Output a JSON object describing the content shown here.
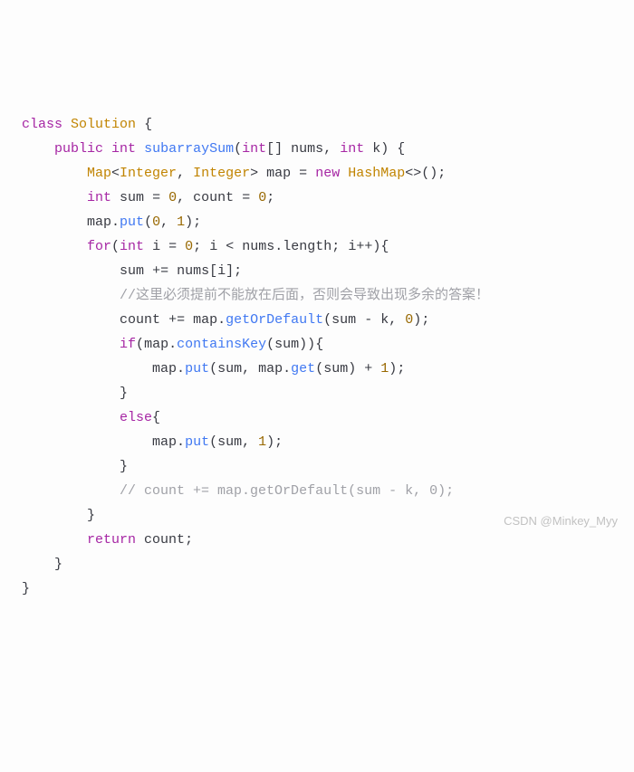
{
  "code": {
    "l1": {
      "kw_class": "class",
      "cls": "Solution",
      "brace": "{"
    },
    "l2": {
      "kw_public": "public",
      "kw_int": "int",
      "fn": "subarraySum",
      "p_open": "(",
      "kw_int2": "int",
      "arr": "[]",
      "var_nums": "nums",
      "comma": ",",
      "kw_int3": "int",
      "var_k": "k",
      "p_close": ")",
      "brace": "{"
    },
    "l3": {
      "cls_map": "Map",
      "lt": "<",
      "cls_int1": "Integer",
      "comma": ",",
      "cls_int2": "Integer",
      "gt": ">",
      "var_map": "map",
      "eq": "=",
      "kw_new": "new",
      "cls_hash": "HashMap",
      "diam": "<>",
      "call": "()",
      "semi": ";"
    },
    "l4": {
      "kw_int": "int",
      "var_sum": "sum",
      "eq1": "=",
      "n0": "0",
      "comma": ",",
      "var_count": "count",
      "eq2": "=",
      "n0b": "0",
      "semi": ";"
    },
    "l5": {
      "var_map": "map",
      "dot": ".",
      "fn_put": "put",
      "p_open": "(",
      "n0": "0",
      "comma": ",",
      "n1": "1",
      "p_close": ")",
      "semi": ";"
    },
    "l6": {
      "kw_for": "for",
      "p_open": "(",
      "kw_int": "int",
      "var_i": "i",
      "eq": "=",
      "n0": "0",
      "semi1": ";",
      "var_i2": "i",
      "lt": "<",
      "var_nums": "nums",
      "dot": ".",
      "var_len": "length",
      "semi2": ";",
      "var_i3": "i",
      "inc": "++",
      "p_close": ")",
      "brace": "{"
    },
    "l7": {
      "var_sum": "sum",
      "pluseq": "+=",
      "var_nums": "nums",
      "b_open": "[",
      "var_i": "i",
      "b_close": "]",
      "semi": ";"
    },
    "l8": {
      "cmt": "//这里必须提前不能放在后面，否则会导致出现多余的答案！"
    },
    "l9": {
      "var_count": "count",
      "pluseq": "+=",
      "var_map": "map",
      "dot": ".",
      "fn_get": "getOrDefault",
      "p_open": "(",
      "var_sum": "sum",
      "minus": "-",
      "var_k": "k",
      "comma": ",",
      "n0": "0",
      "p_close": ")",
      "semi": ";"
    },
    "l10": {
      "kw_if": "if",
      "p_open": "(",
      "var_map": "map",
      "dot": ".",
      "fn_ck": "containsKey",
      "p_open2": "(",
      "var_sum": "sum",
      "p_close2": ")",
      "p_close": ")",
      "brace": "{"
    },
    "l11": {
      "var_map": "map",
      "dot": ".",
      "fn_put": "put",
      "p_open": "(",
      "var_sum": "sum",
      "comma": ",",
      "var_map2": "map",
      "dot2": ".",
      "fn_get": "get",
      "p_open2": "(",
      "var_sum2": "sum",
      "p_close2": ")",
      "plus": "+",
      "n1": "1",
      "p_close": ")",
      "semi": ";"
    },
    "l12": {
      "brace": "}"
    },
    "l13": {
      "kw_else": "else",
      "brace": "{"
    },
    "l14": {
      "var_map": "map",
      "dot": ".",
      "fn_put": "put",
      "p_open": "(",
      "var_sum": "sum",
      "comma": ",",
      "n1": "1",
      "p_close": ")",
      "semi": ";"
    },
    "l15": {
      "brace": "}"
    },
    "l16": {
      "cmt": "// count += map.getOrDefault(sum - k, 0);"
    },
    "l17": {
      "brace": "}"
    },
    "l18": {
      "kw_return": "return",
      "var_count": "count",
      "semi": ";"
    },
    "l19": {
      "brace": "}"
    },
    "l20": {
      "brace": "}"
    }
  },
  "watermark": "CSDN @Minkey_Myy"
}
